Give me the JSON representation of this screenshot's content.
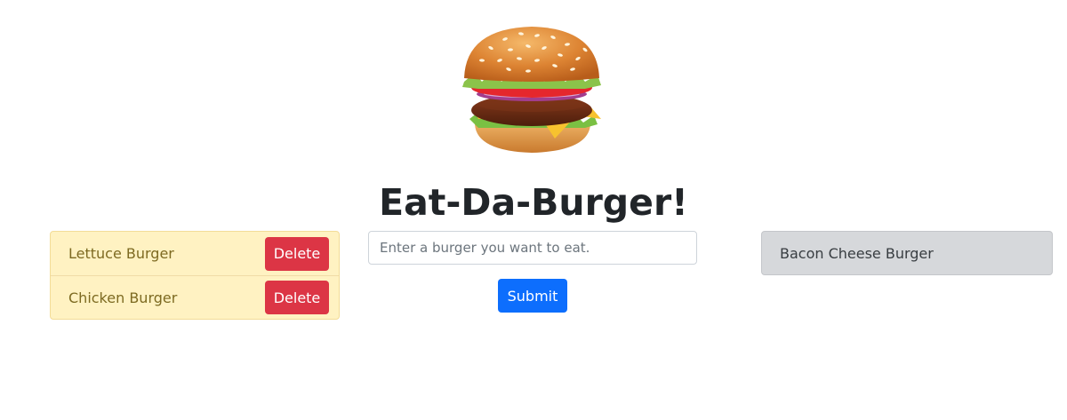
{
  "header": {
    "logo_icon": "burger-icon",
    "title": "Eat-Da-Burger!"
  },
  "uneaten_list": {
    "items": [
      {
        "label": "Lettuce Burger",
        "action_label": "Delete"
      },
      {
        "label": "Chicken Burger",
        "action_label": "Delete"
      }
    ]
  },
  "form": {
    "input_placeholder": "Enter a burger you want to eat.",
    "input_value": "",
    "submit_label": "Submit"
  },
  "eaten_list": {
    "items": [
      {
        "label": "Bacon Cheese Burger"
      }
    ]
  },
  "colors": {
    "delete_button": "#dc3545",
    "submit_button": "#0d6efd",
    "uneaten_background": "#fff2c2",
    "eaten_background": "#d6d8db"
  }
}
